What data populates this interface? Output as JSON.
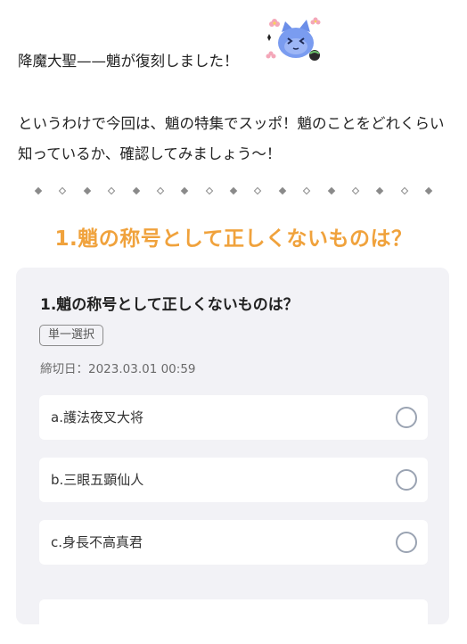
{
  "post": {
    "intro_line1": "降魔大聖——魈が復刻しました！",
    "intro_line2": "というわけで今回は、魈の特集でスッポ！魈のことをどれくらい知っているか、確認してみましょう〜！",
    "mascot_icon": "cat-mascot-icon"
  },
  "section_heading": "1.魈の称号として正しくないものは？",
  "poll": {
    "title": "1.魈の称号として正しくないものは？",
    "type_badge": "単一選択",
    "deadline": "締切日：2023.03.01 00:59",
    "options": [
      {
        "label": "a.護法夜叉大将",
        "selected": false
      },
      {
        "label": "b.三眼五顕仙人",
        "selected": false
      },
      {
        "label": "c.身長不高真君",
        "selected": false
      }
    ]
  },
  "colors": {
    "accent_heading": "#f0a23c",
    "card_background": "#f2f2f6",
    "radio_border": "#9aa3b2"
  }
}
